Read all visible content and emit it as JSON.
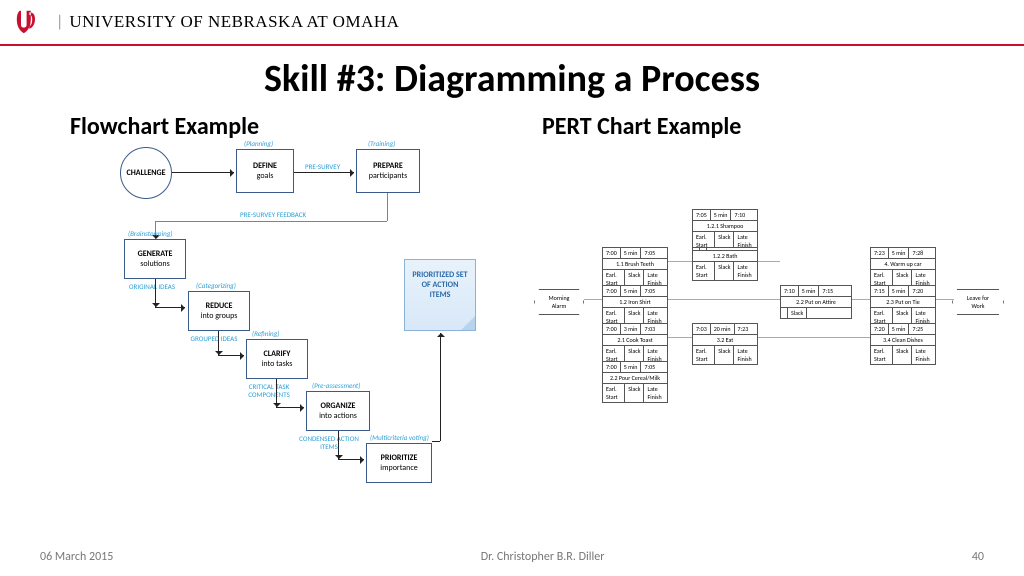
{
  "university": "UNIVERSITY OF NEBRASKA AT OMAHA",
  "title": "Skill #3: Diagramming a Process",
  "subtitle_left": "Flowchart Example",
  "subtitle_right": "PERT Chart Example",
  "flowchart": {
    "challenge": "CHALLENGE",
    "define_tag": "(Planning)",
    "define": "DEFINE",
    "define_sub": "goals",
    "prepare_tag": "(Training)",
    "prepare": "PREPARE",
    "prepare_sub": "participants",
    "presurvey": "PRE-SURVEY",
    "feedback": "PRE-SURVEY FEEDBACK",
    "generate_tag": "(Brainstorming)",
    "generate": "GENERATE",
    "generate_sub": "solutions",
    "orig": "ORIGINAL IDEAS",
    "reduce_tag": "(Categorizing)",
    "reduce": "REDUCE",
    "reduce_sub": "into groups",
    "grouped": "GROUPED IDEAS",
    "clarify_tag": "(Refining)",
    "clarify": "CLARIFY",
    "clarify_sub": "into tasks",
    "crit": "CRITICAL TASK COMPONENTS",
    "organize_tag": "(Pre-assessment)",
    "organize": "ORGANIZE",
    "organize_sub": "into actions",
    "cond": "CONDENSED ACTION ITEMS",
    "prioritize_tag": "(Multicriteria voting)",
    "prioritize": "PRIORITIZE",
    "prioritize_sub": "importance",
    "note": "PRIORITIZED SET OF ACTION ITEMS"
  },
  "pert": {
    "start": "Morning Alarm",
    "end": "Leave for Work",
    "n11": {
      "t1": "7:00",
      "d": "5 min",
      "t2": "7:05",
      "task": "1.1 Brush Teeth",
      "a": "Earl. Start",
      "b": "Slack",
      "c": "Late Finish"
    },
    "n12": {
      "t1": "7:00",
      "d": "5 min",
      "t2": "7:05",
      "task": "1.2 Iron Shirt",
      "a": "Earl. Start",
      "b": "Slack",
      "c": "Late Finish"
    },
    "n13": {
      "t1": "7:00",
      "d": "3 min",
      "t2": "7:03",
      "task": "2.1 Cook Toast",
      "a": "Earl. Start",
      "b": "Slack",
      "c": "Late Finish"
    },
    "n14": {
      "t1": "7:00",
      "d": "5 min",
      "t2": "7:05",
      "task": "2.2 Pour Cereal/Milk",
      "a": "Earl. Start",
      "b": "Slack",
      "c": "Late Finish"
    },
    "n21": {
      "t1": "7:05",
      "d": "5 min",
      "t2": "7:10",
      "task": "1.2.1 Shampoo",
      "a": "Earl. Start",
      "b": "Slack",
      "c": "Late Finish"
    },
    "n22": {
      "t1": "",
      "d": "",
      "t2": "",
      "task": "1.2.2 Bath",
      "a": "Earl. Start",
      "b": "Slack",
      "c": "Late Finish"
    },
    "n23": {
      "t1": "7:03",
      "d": "20 min",
      "t2": "7:23",
      "task": "3.2 Eat",
      "a": "Earl. Start",
      "b": "Slack",
      "c": "Late Finish"
    },
    "n31": {
      "t1": "7:10",
      "d": "5 min",
      "t2": "7:15",
      "task": "2.2 Put on Attire",
      "a": "",
      "b": "Slack",
      "c": ""
    },
    "n41": {
      "t1": "7:23",
      "d": "5 min",
      "t2": "7:28",
      "task": "4. Warm up car",
      "a": "Earl. Start",
      "b": "Slack",
      "c": "Late Finish"
    },
    "n42": {
      "t1": "7:20",
      "d": "5 min",
      "t2": "7:25",
      "task": "3.4 Clean Dishes",
      "a": "Earl. Start",
      "b": "Slack",
      "c": "Late Finish"
    },
    "n43": {
      "t1": "7:15",
      "d": "5 min",
      "t2": "7:20",
      "task": "2.3 Put on Tie",
      "a": "Earl. Start",
      "b": "Slack",
      "c": "Late Finish"
    }
  },
  "footer": {
    "date": "06 March 2015",
    "author": "Dr. Christopher B.R. Diller",
    "page": "40"
  }
}
